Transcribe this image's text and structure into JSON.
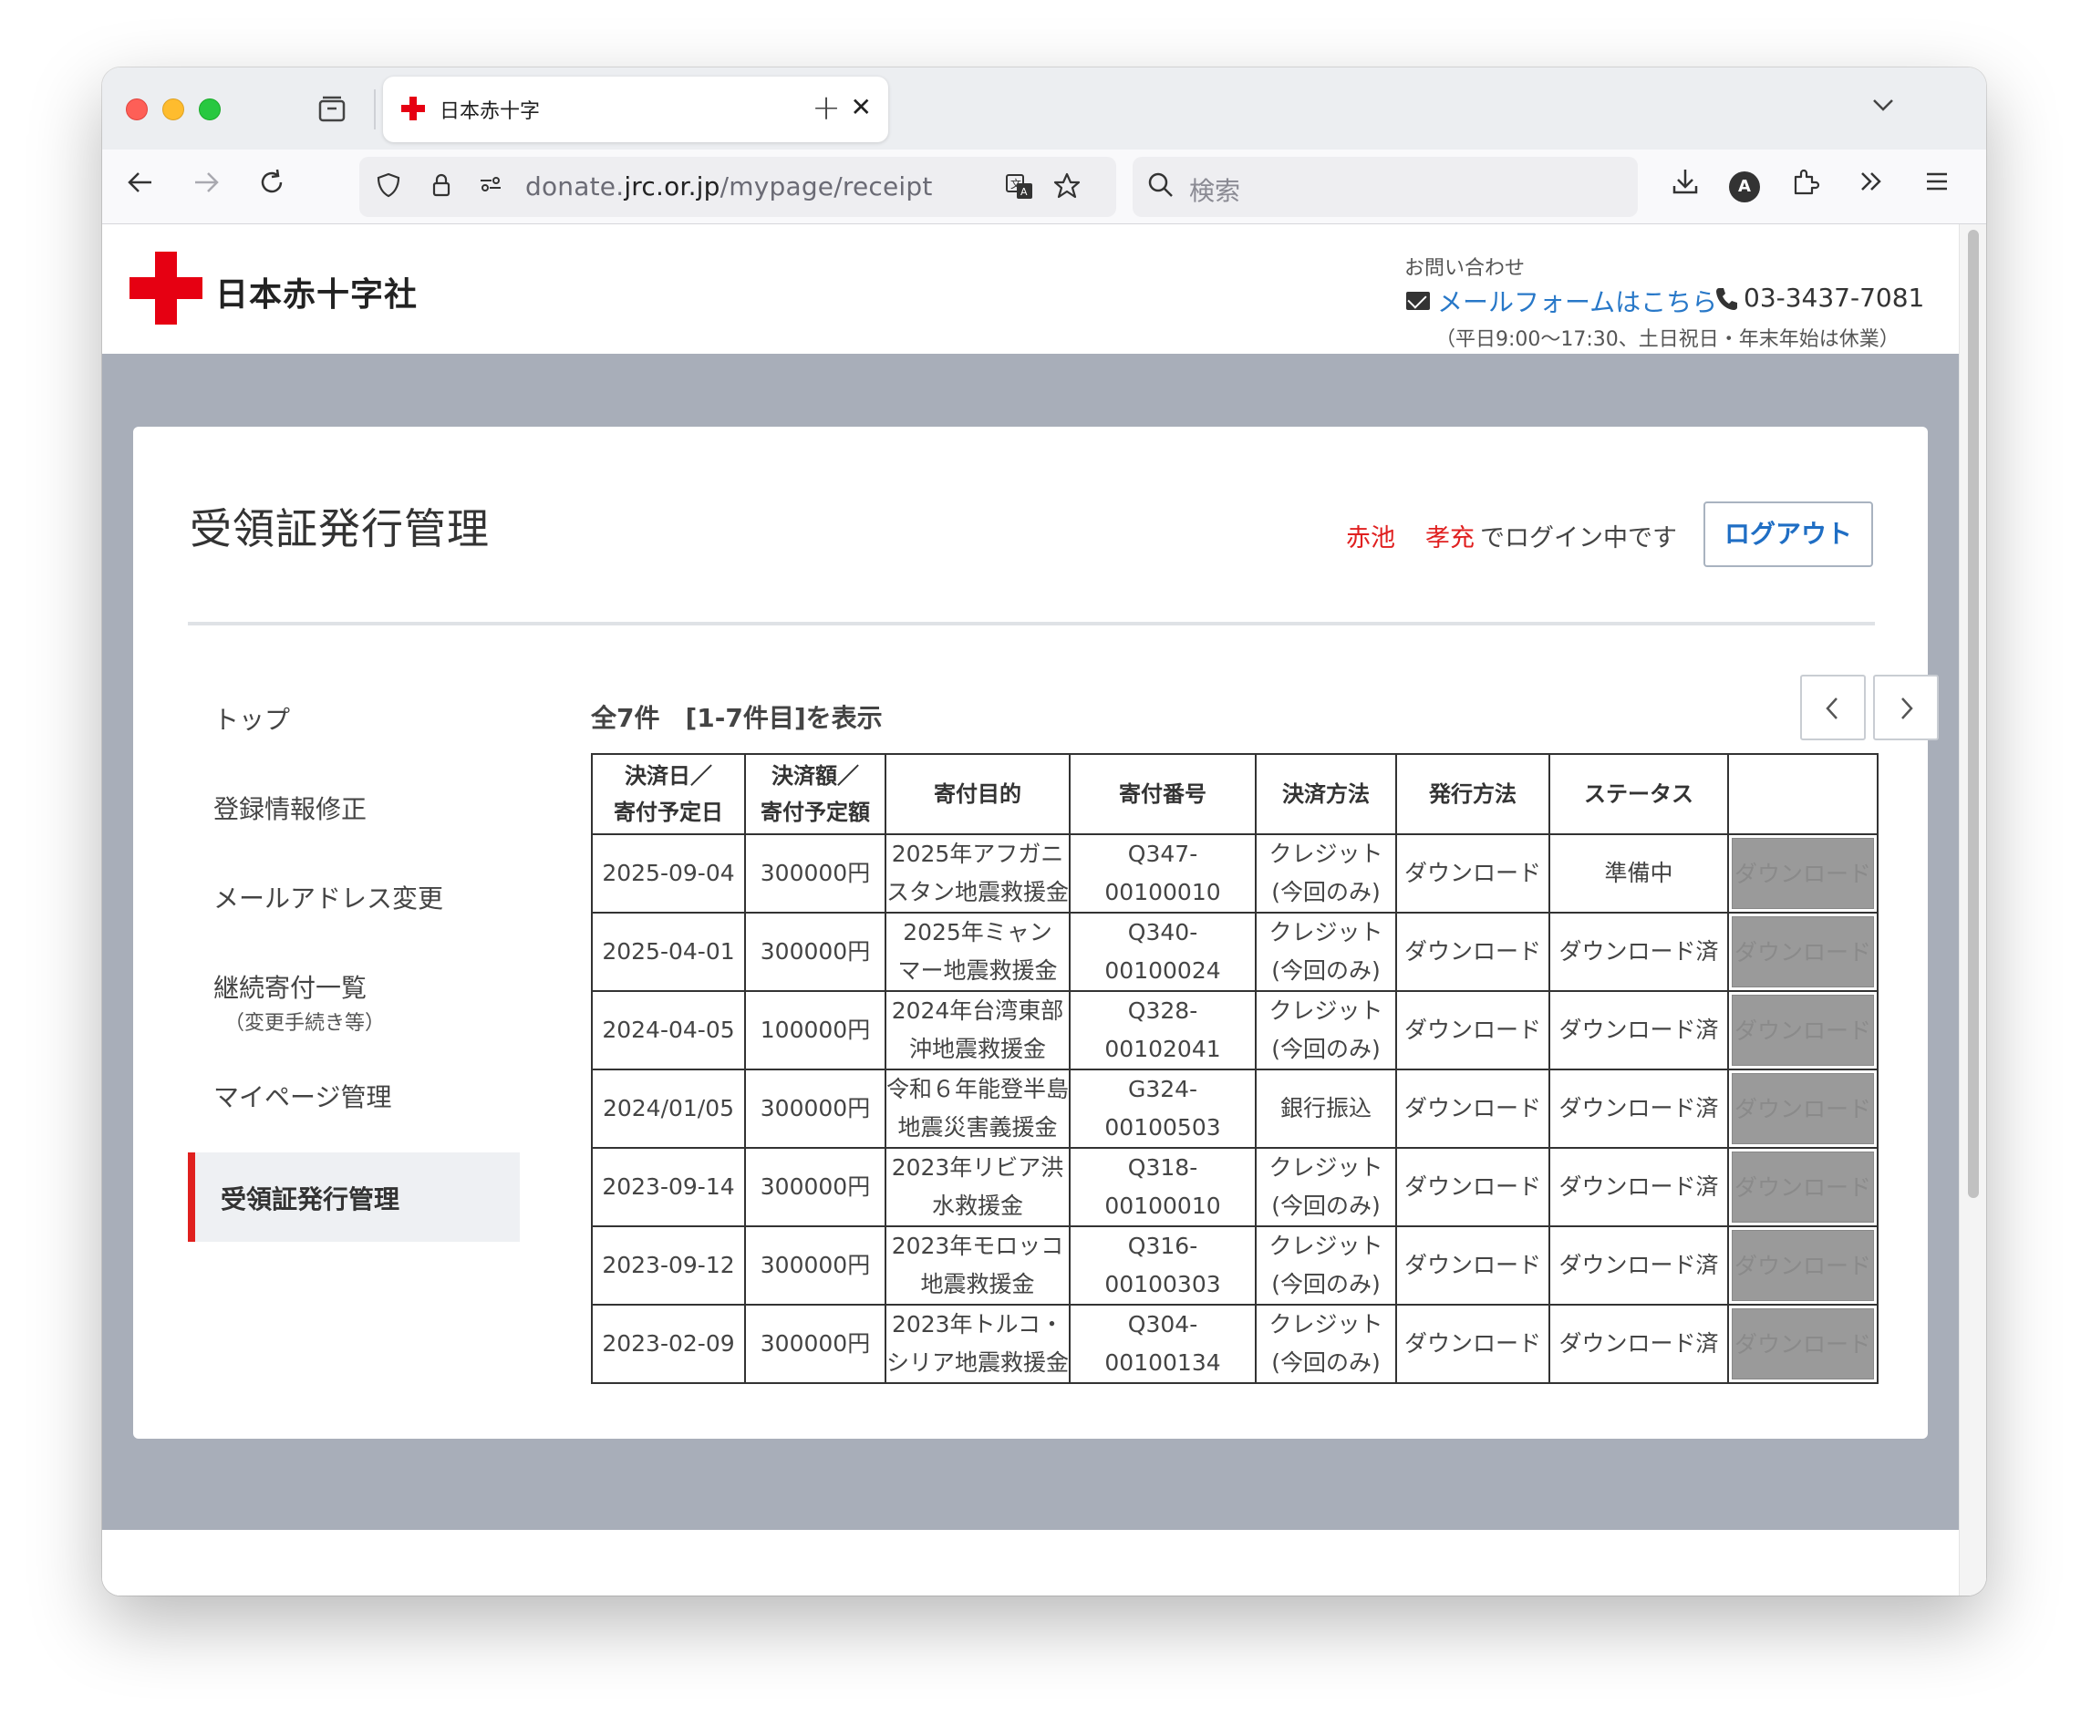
{
  "browser": {
    "tab_title": "日本赤十字",
    "url_prefix": "donate.",
    "url_domain": "jrc.or.jp",
    "url_path": "/mypage/receipt",
    "search_placeholder": "検索",
    "avatar_letter": "A"
  },
  "site": {
    "logo_text": "日本赤十字社",
    "contact_label": "お問い合わせ",
    "contact_link": "メールフォームはこちら",
    "phone": "03-3437-7081",
    "hours": "（平日9:00〜17:30、土日祝日・年末年始は休業）"
  },
  "page": {
    "title": "受領証発行管理",
    "user_name_last": "赤池",
    "user_name_first": "孝充",
    "login_suffix": "でログイン中です",
    "logout_label": "ログアウト",
    "count_text": "全7件　[1-7件目]を表示"
  },
  "sidebar": {
    "items": [
      {
        "label": "トップ",
        "sub": ""
      },
      {
        "label": "登録情報修正",
        "sub": ""
      },
      {
        "label": "メールアドレス変更",
        "sub": ""
      },
      {
        "label": "継続寄付一覧",
        "sub": "（変更手続き等）"
      },
      {
        "label": "マイページ管理",
        "sub": ""
      },
      {
        "label": "受領証発行管理",
        "sub": ""
      }
    ],
    "active_index": 5
  },
  "table": {
    "headers": [
      [
        "決済日／",
        "寄付予定日"
      ],
      [
        "決済額／",
        "寄付予定額"
      ],
      [
        "寄付目的"
      ],
      [
        "寄付番号"
      ],
      [
        "決済方法"
      ],
      [
        "発行方法"
      ],
      [
        "ステータス"
      ],
      [
        ""
      ]
    ],
    "rows": [
      {
        "date": "2025-09-04",
        "amount": "300000円",
        "purpose": [
          "2025年アフガニ",
          "スタン地震救援金"
        ],
        "number": "Q347-00100010",
        "method": [
          "クレジット",
          "(今回のみ)"
        ],
        "issue": "ダウンロード",
        "status": "準備中",
        "action": "ダウンロード"
      },
      {
        "date": "2025-04-01",
        "amount": "300000円",
        "purpose": [
          "2025年ミャン",
          "マー地震救援金"
        ],
        "number": "Q340-00100024",
        "method": [
          "クレジット",
          "(今回のみ)"
        ],
        "issue": "ダウンロード",
        "status": "ダウンロード済",
        "action": "ダウンロード"
      },
      {
        "date": "2024-04-05",
        "amount": "100000円",
        "purpose": [
          "2024年台湾東部",
          "沖地震救援金"
        ],
        "number": "Q328-00102041",
        "method": [
          "クレジット",
          "(今回のみ)"
        ],
        "issue": "ダウンロード",
        "status": "ダウンロード済",
        "action": "ダウンロード"
      },
      {
        "date": "2024/01/05",
        "amount": "300000円",
        "purpose": [
          "令和６年能登半島",
          "地震災害義援金"
        ],
        "number": "G324-00100503",
        "method": [
          "銀行振込"
        ],
        "issue": "ダウンロード",
        "status": "ダウンロード済",
        "action": "ダウンロード"
      },
      {
        "date": "2023-09-14",
        "amount": "300000円",
        "purpose": [
          "2023年リビア洪",
          "水救援金"
        ],
        "number": "Q318-00100010",
        "method": [
          "クレジット",
          "(今回のみ)"
        ],
        "issue": "ダウンロード",
        "status": "ダウンロード済",
        "action": "ダウンロード"
      },
      {
        "date": "2023-09-12",
        "amount": "300000円",
        "purpose": [
          "2023年モロッコ",
          "地震救援金"
        ],
        "number": "Q316-00100303",
        "method": [
          "クレジット",
          "(今回のみ)"
        ],
        "issue": "ダウンロード",
        "status": "ダウンロード済",
        "action": "ダウンロード"
      },
      {
        "date": "2023-02-09",
        "amount": "300000円",
        "purpose": [
          "2023年トルコ・",
          "シリア地震救援金"
        ],
        "number": "Q304-00100134",
        "method": [
          "クレジット",
          "(今回のみ)"
        ],
        "issue": "ダウンロード",
        "status": "ダウンロード済",
        "action": "ダウンロード"
      }
    ]
  },
  "colors": {
    "brand_red": "#e60012",
    "link_blue": "#2878c8",
    "band_gray": "#a8aeb9"
  }
}
